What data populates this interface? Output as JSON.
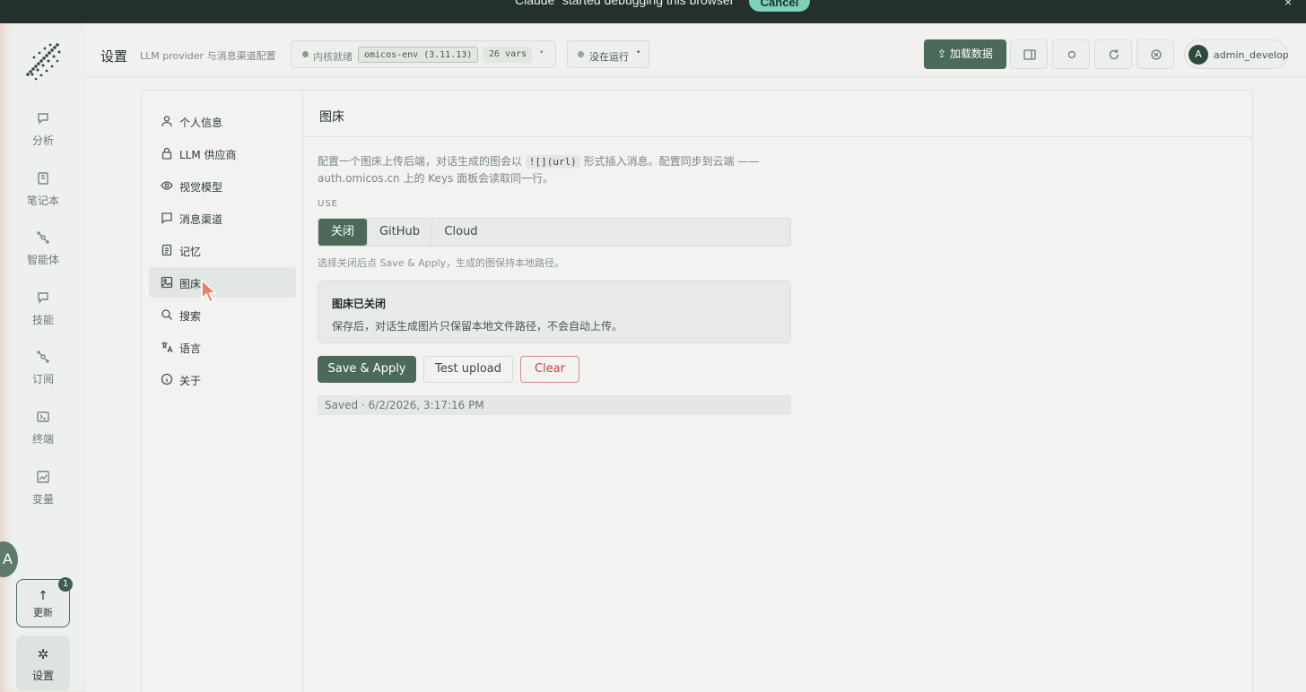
{
  "banner": {
    "message": "Claude “started debugging this browser”",
    "cancel_label": "Cancel",
    "close_label": "×"
  },
  "rail": {
    "items": [
      {
        "label": "分析",
        "icon": "chat-icon"
      },
      {
        "label": "笔记本",
        "icon": "notebook-icon"
      },
      {
        "label": "智能体",
        "icon": "agent-icon"
      },
      {
        "label": "技能",
        "icon": "chat-icon"
      },
      {
        "label": "订阅",
        "icon": "agent-icon"
      },
      {
        "label": "终端",
        "icon": "terminal-icon"
      },
      {
        "label": "变量",
        "icon": "chart-icon"
      }
    ],
    "lang_bubble": "A",
    "update": {
      "label": "更新",
      "badge": "1"
    },
    "settings": {
      "label": "设置"
    },
    "avatar": "A"
  },
  "header": {
    "title": "设置",
    "subtitle": "LLM provider 与消息渠道配置",
    "kernel": {
      "status": "内核就绪",
      "env": "omicos-env (3.11.13)",
      "vars": "26 vars",
      "chevron": "•"
    },
    "run": {
      "status": "没在运行",
      "chevron": "•"
    },
    "load_button": "加载数据",
    "user": {
      "initial": "A",
      "name": "admin_develop"
    }
  },
  "nav": {
    "items": [
      {
        "label": "个人信息",
        "icon": "user-icon"
      },
      {
        "label": "LLM 供应商",
        "icon": "lock-icon"
      },
      {
        "label": "视觉模型",
        "icon": "eye-icon"
      },
      {
        "label": "消息渠道",
        "icon": "message-icon"
      },
      {
        "label": "记忆",
        "icon": "document-icon"
      },
      {
        "label": "图床",
        "icon": "image-icon",
        "active": true
      },
      {
        "label": "搜索",
        "icon": "search-icon"
      },
      {
        "label": "语言",
        "icon": "translate-icon"
      },
      {
        "label": "关于",
        "icon": "info-icon"
      }
    ]
  },
  "content": {
    "title": "图床",
    "desc_before": "配置一个图床上传后端，对话生成的图会以 ",
    "desc_code": "![](url)",
    "desc_after": " 形式插入消息。配置同步到云端 —— auth.omicos.cn 上的 Keys 面板会读取同一行。",
    "use_label": "USE",
    "options": [
      "关闭",
      "GitHub",
      "Cloud"
    ],
    "selected_option": "关闭",
    "hint": "选择关闭后点 Save & Apply，生成的图保持本地路径。",
    "notice_title": "图床已关闭",
    "notice_body": "保存后，对话生成图片只保留本地文件路径，不会自动上传。",
    "save_button": "Save & Apply",
    "test_button": "Test upload",
    "clear_button": "Clear",
    "saved_status": "Saved · 6/2/2026, 3:17:16 PM"
  },
  "colors": {
    "accent": "#4b6a5a",
    "danger": "#c24545",
    "banner_bg": "#23302b",
    "cancel_bg": "#7fd0b8"
  }
}
